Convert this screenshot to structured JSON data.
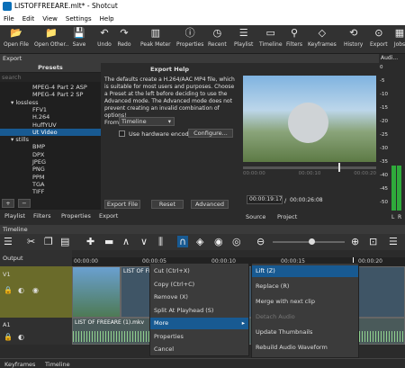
{
  "window": {
    "title": "LISTOFFREEARE.mlt* - Shotcut"
  },
  "menu": [
    "File",
    "Edit",
    "View",
    "Settings",
    "Help"
  ],
  "toolbar": [
    {
      "label": "Open File",
      "icon": "folder-open-icon"
    },
    {
      "label": "Open Other..",
      "icon": "folder-plus-icon"
    },
    {
      "label": "Save",
      "icon": "save-icon"
    },
    {
      "label": "Undo",
      "icon": "undo-icon"
    },
    {
      "label": "Redo",
      "icon": "redo-icon"
    },
    {
      "label": "Peak Meter",
      "icon": "peak-meter-icon"
    },
    {
      "label": "Properties",
      "icon": "properties-icon"
    },
    {
      "label": "Recent",
      "icon": "recent-icon"
    },
    {
      "label": "Playlist",
      "icon": "playlist-icon"
    },
    {
      "label": "Timeline",
      "icon": "timeline-icon"
    },
    {
      "label": "Filters",
      "icon": "filters-icon"
    },
    {
      "label": "Keyframes",
      "icon": "keyframes-icon"
    },
    {
      "label": "History",
      "icon": "history-icon"
    },
    {
      "label": "Export",
      "icon": "export-icon"
    },
    {
      "label": "Jobs",
      "icon": "jobs-icon"
    }
  ],
  "export": {
    "header": "Export",
    "presets_header": "Presets",
    "search_placeholder": "search",
    "presets": [
      {
        "label": "MPEG-4 Part 2 ASP",
        "indent": 3
      },
      {
        "label": "MPEG-4 Part 2 SP",
        "indent": 3
      },
      {
        "label": "▾ lossless",
        "indent": 1
      },
      {
        "label": "FFV1",
        "indent": 3
      },
      {
        "label": "H.264",
        "indent": 3
      },
      {
        "label": "HuffYUV",
        "indent": 3
      },
      {
        "label": "Ut Video",
        "indent": 3,
        "selected": true
      },
      {
        "label": "▾ stills",
        "indent": 1
      },
      {
        "label": "BMP",
        "indent": 3
      },
      {
        "label": "DPX",
        "indent": 3
      },
      {
        "label": "JPEG",
        "indent": 3
      },
      {
        "label": "PNG",
        "indent": 3
      },
      {
        "label": "PPM",
        "indent": 3
      },
      {
        "label": "TGA",
        "indent": 3
      },
      {
        "label": "TIFF",
        "indent": 3
      }
    ],
    "help_title": "Export Help",
    "help_text": "The defaults create a H.264/AAC MP4 file, which is suitable for most users and purposes. Choose a Preset at the left before deciding to use the Advanced mode. The Advanced mode does not prevent creating an invalid combination of options!",
    "from_label": "From",
    "from_value": "Timeline",
    "hw_encoder": "Use hardware encoder",
    "configure": "Configure...",
    "export_file": "Export File",
    "reset": "Reset",
    "advanced": "Advanced",
    "left_tabs": [
      "Playlist",
      "Filters",
      "Properties",
      "Export"
    ]
  },
  "player": {
    "timecode_current": "00:00:19:17",
    "timecode_total": "00:00:26:08",
    "tabs": [
      "Source",
      "Project"
    ]
  },
  "audio": {
    "header": "Audi...",
    "scale": [
      "0",
      "-5",
      "-10",
      "-15",
      "-20",
      "-25",
      "-30",
      "-35",
      "-40",
      "-45",
      "-50"
    ],
    "channels": [
      "L",
      "R"
    ]
  },
  "timeline": {
    "header": "Timeline",
    "ruler": [
      "00:00:00",
      "00:00:05",
      "00:00:10",
      "00:00:15",
      "00:00:20"
    ],
    "output_label": "Output",
    "v1_label": "V1",
    "a1_label": "A1",
    "clip_v": "LIST OF FREEARE (1).mkv",
    "clip_a": "LIST OF FREEARE (1).mkv"
  },
  "context_menu": [
    "Cut (Ctrl+X)",
    "Copy (Ctrl+C)",
    "Remove (X)",
    "Split At Playhead (S)",
    "More",
    "Properties",
    "Cancel"
  ],
  "submenu": [
    "Lift (Z)",
    "Replace (R)",
    "Merge with next clip",
    "Detach Audio",
    "Update Thumbnails",
    "Rebuild Audio Waveform"
  ],
  "bottom_tabs": [
    "Keyframes",
    "Timeline"
  ]
}
